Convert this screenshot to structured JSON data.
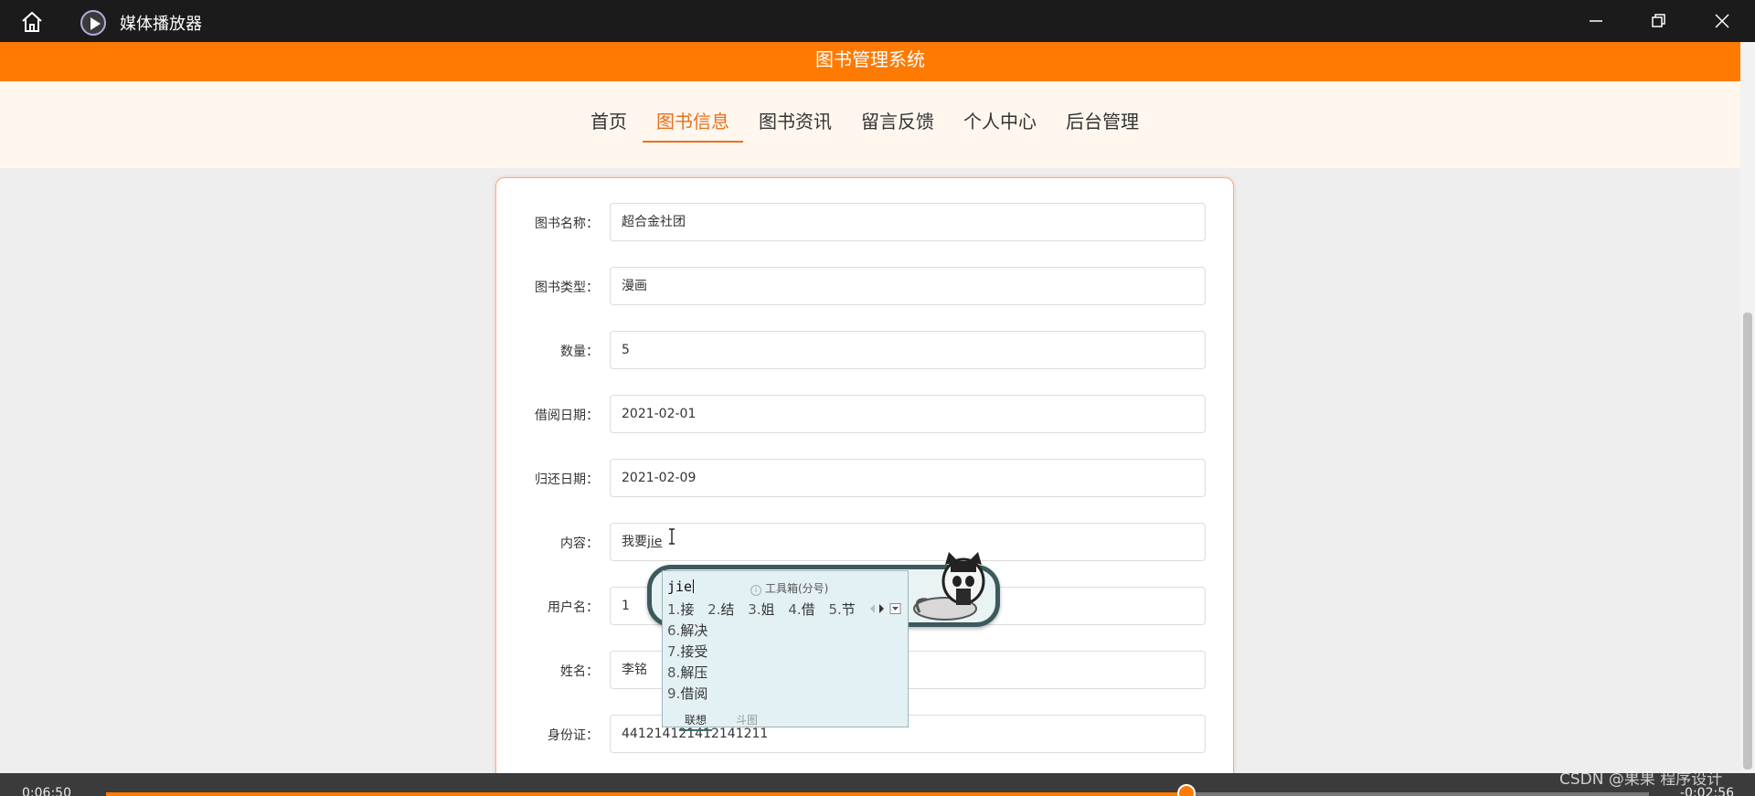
{
  "window": {
    "title": "媒体播放器",
    "icons": {
      "home": "home-icon",
      "app": "media-player-icon",
      "minimize": "minimize-icon",
      "maximize": "restore-icon",
      "close": "close-icon"
    }
  },
  "site": {
    "title": "图书管理系统",
    "accent": "#ff7a00"
  },
  "nav": {
    "items": [
      {
        "label": "首页"
      },
      {
        "label": "图书信息"
      },
      {
        "label": "图书资讯"
      },
      {
        "label": "留言反馈"
      },
      {
        "label": "个人中心"
      },
      {
        "label": "后台管理"
      }
    ],
    "active": "图书信息"
  },
  "form": {
    "fields": [
      {
        "label": "图书名称：",
        "value": "超合金社团"
      },
      {
        "label": "图书类型：",
        "value": "漫画"
      },
      {
        "label": "数量：",
        "value": "5"
      },
      {
        "label": "借阅日期：",
        "value": "2021-02-01"
      },
      {
        "label": "归还日期：",
        "value": "2021-02-09"
      },
      {
        "label": "内容：",
        "value": "我要",
        "composition": "jie"
      },
      {
        "label": "用户名：",
        "value": "1"
      },
      {
        "label": "姓名：",
        "value": "李铭"
      },
      {
        "label": "身份证：",
        "value": "441214121412141211"
      }
    ]
  },
  "ime": {
    "input": "jie",
    "toolbox": "工具箱(分号)",
    "candidates_row": [
      {
        "num": "1.",
        "text": "接"
      },
      {
        "num": "2.",
        "text": "结"
      },
      {
        "num": "3.",
        "text": "姐"
      },
      {
        "num": "4.",
        "text": "借"
      },
      {
        "num": "5.",
        "text": "节"
      }
    ],
    "candidates_list": [
      {
        "num": "6.",
        "text": "解决"
      },
      {
        "num": "7.",
        "text": "接受"
      },
      {
        "num": "8.",
        "text": "解压"
      },
      {
        "num": "9.",
        "text": "借阅"
      }
    ],
    "tabs": [
      "联想",
      "斗图"
    ]
  },
  "player": {
    "elapsed": "0:06:50",
    "remaining": "-0:02:56",
    "progress": 0.7,
    "watermark": "CSDN @果果 程序设计"
  }
}
